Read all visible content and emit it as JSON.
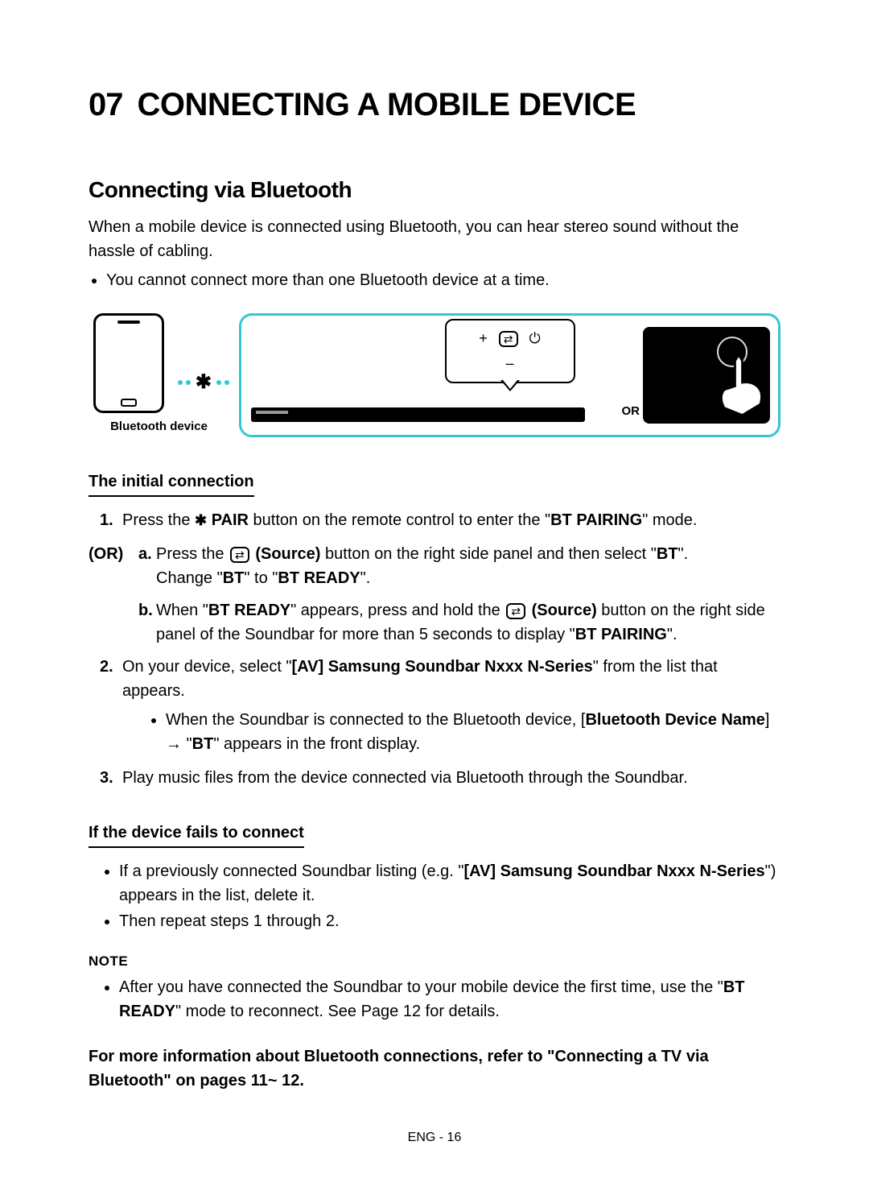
{
  "chapter": {
    "num": "07",
    "title": "CONNECTING A MOBILE DEVICE"
  },
  "section1": {
    "heading": "Connecting via Bluetooth",
    "intro": "When a mobile device is connected using Bluetooth, you can hear stereo sound without the hassle of cabling.",
    "limit": "You cannot connect more than one Bluetooth device at a time."
  },
  "diagram": {
    "bt_device_label": "Bluetooth device",
    "or_label": "OR"
  },
  "initial": {
    "heading": "The initial connection",
    "step1_num": "1.",
    "step1_pre": "Press the ",
    "step1_pair": " PAIR",
    "step1_post": " button on the remote control to enter the \"",
    "step1_mode": "BT PAIRING",
    "step1_end": "\" mode.",
    "or_label": "(OR)",
    "sub_a_letter": "a.",
    "sub_a_pre": "Press the ",
    "sub_a_source": " (Source)",
    "sub_a_mid": " button on the right side panel and then select \"",
    "sub_a_bt": "BT",
    "sub_a_post": "\".",
    "sub_a_line2_pre": "Change \"",
    "sub_a_line2_bt": "BT",
    "sub_a_line2_mid": "\" to \"",
    "sub_a_line2_ready": "BT READY",
    "sub_a_line2_post": "\".",
    "sub_b_letter": "b.",
    "sub_b_pre": "When \"",
    "sub_b_ready": "BT READY",
    "sub_b_mid": "\" appears, press and hold the ",
    "sub_b_source": " (Source)",
    "sub_b_post": " button on the right side panel of the Soundbar for more than 5 seconds to display \"",
    "sub_b_pairing": "BT PAIRING",
    "sub_b_end": "\".",
    "step2_num": "2.",
    "step2_pre": "On your device, select \"",
    "step2_name": "[AV] Samsung Soundbar Nxxx N-Series",
    "step2_post": "\" from the list that appears.",
    "step2_bullet_pre": "When the Soundbar is connected to the Bluetooth device, [",
    "step2_bullet_name": "Bluetooth Device Name",
    "step2_bullet_arrow": "] → \"",
    "step2_bullet_bt": "BT",
    "step2_bullet_post": "\" appears in the front display.",
    "step3_num": "3.",
    "step3": "Play music files from the device connected via Bluetooth through the Soundbar."
  },
  "fails": {
    "heading": "If the device fails to connect",
    "b1_pre": "If a previously connected Soundbar listing (e.g. \"",
    "b1_name": "[AV] Samsung Soundbar Nxxx N-Series",
    "b1_post": "\") appears in the list, delete it.",
    "b2": "Then repeat steps 1 through 2."
  },
  "note": {
    "heading": "NOTE",
    "pre": "After you have connected the Soundbar to your mobile device the first time, use the \"",
    "ready": "BT READY",
    "post": "\" mode to reconnect. See Page 12 for details."
  },
  "more_info": "For more information about Bluetooth connections, refer to \"Connecting a TV via Bluetooth\" on pages 11~ 12.",
  "footer": "ENG - 16"
}
